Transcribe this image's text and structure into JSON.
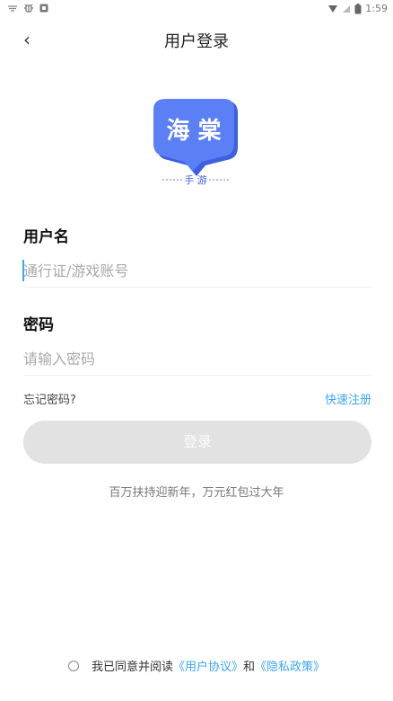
{
  "status_bar": {
    "time": "1:59",
    "left_icons": [
      "wifi-icon",
      "bug-icon",
      "notification-icon"
    ],
    "right_icons": [
      "signal-icon",
      "sim-icon",
      "battery-icon"
    ]
  },
  "nav": {
    "back_icon": "‹",
    "title": "用户登录"
  },
  "logo": {
    "line1": "海 棠",
    "line2": "手 游",
    "color_primary": "#5b7ff5",
    "color_shadow": "#3e5fe0"
  },
  "username": {
    "label": "用户名",
    "placeholder": "通行证/游戏账号",
    "value": ""
  },
  "password": {
    "label": "密码",
    "placeholder": "请输入密码",
    "value": ""
  },
  "links": {
    "forgot": "忘记密码?",
    "register": "快速注册"
  },
  "login_button": "登录",
  "promo_text": "百万扶持迎新年，万元红包过大年",
  "agreement": {
    "prefix": "我已同意并阅读",
    "user_agreement": "《用户协议》",
    "conjunction": "和",
    "privacy_policy": "《隐私政策》",
    "checked": false
  },
  "colors": {
    "accent": "#3aa6f5",
    "button_disabled": "#e2e2e2"
  }
}
